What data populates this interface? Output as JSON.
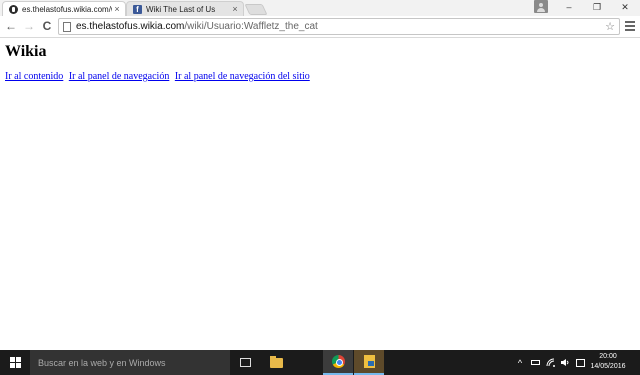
{
  "browser": {
    "tabs": [
      {
        "title": "es.thelastofus.wikia.com/w",
        "active": true,
        "favicon": "wikia-icon"
      },
      {
        "title": "Wiki The Last of Us",
        "active": false,
        "favicon": "facebook-icon"
      }
    ],
    "close_glyph": "×",
    "url_host": "es.thelastofus.wikia.com",
    "url_path": "/wiki/Usuario:Waffletz_the_cat",
    "back_glyph": "←",
    "forward_glyph": "→",
    "reload_glyph": "C",
    "star_glyph": "☆",
    "window_controls": {
      "minimize": "–",
      "restore": "❐",
      "close": "✕"
    }
  },
  "page": {
    "heading": "Wikia",
    "skip_links": [
      "Ir al contenido",
      "Ir al panel de navegación",
      "Ir al panel de navegación del sitio"
    ]
  },
  "taskbar": {
    "search_placeholder": "Buscar en la web y en Windows",
    "tray": {
      "chevron": "^"
    },
    "clock": {
      "time": "20:00",
      "date": "14/05/2016"
    },
    "accent": "#76b9ed"
  }
}
